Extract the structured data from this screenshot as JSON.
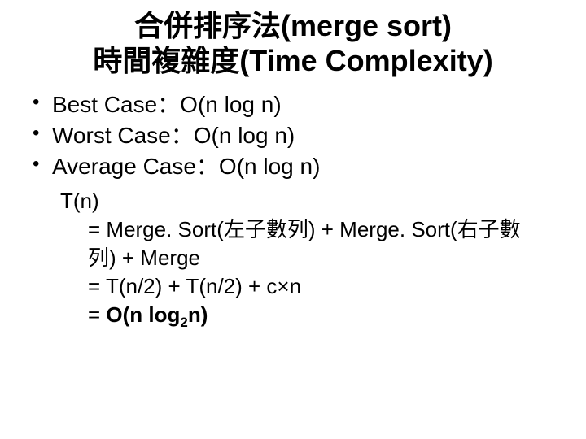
{
  "title_line1": "合併排序法(merge sort)",
  "title_line2": "時間複雜度(Time Complexity)",
  "bullets": {
    "b1": "Best Case：O(n log n)",
    "b2": "Worst Case：O(n log n)",
    "b3": "Average Case：O(n log n)"
  },
  "recurrence": {
    "l1": "T(n)",
    "l2a": "= Merge. Sort(左子數列) + Merge. Sort(右子數",
    "l2b": "列) + Merge",
    "l3": "= T(n/2) + T(n/2) + c×n",
    "l4a": "= ",
    "l4b_bold": "O(n log",
    "l4c_sub": "2",
    "l4d_bold": "n)"
  }
}
